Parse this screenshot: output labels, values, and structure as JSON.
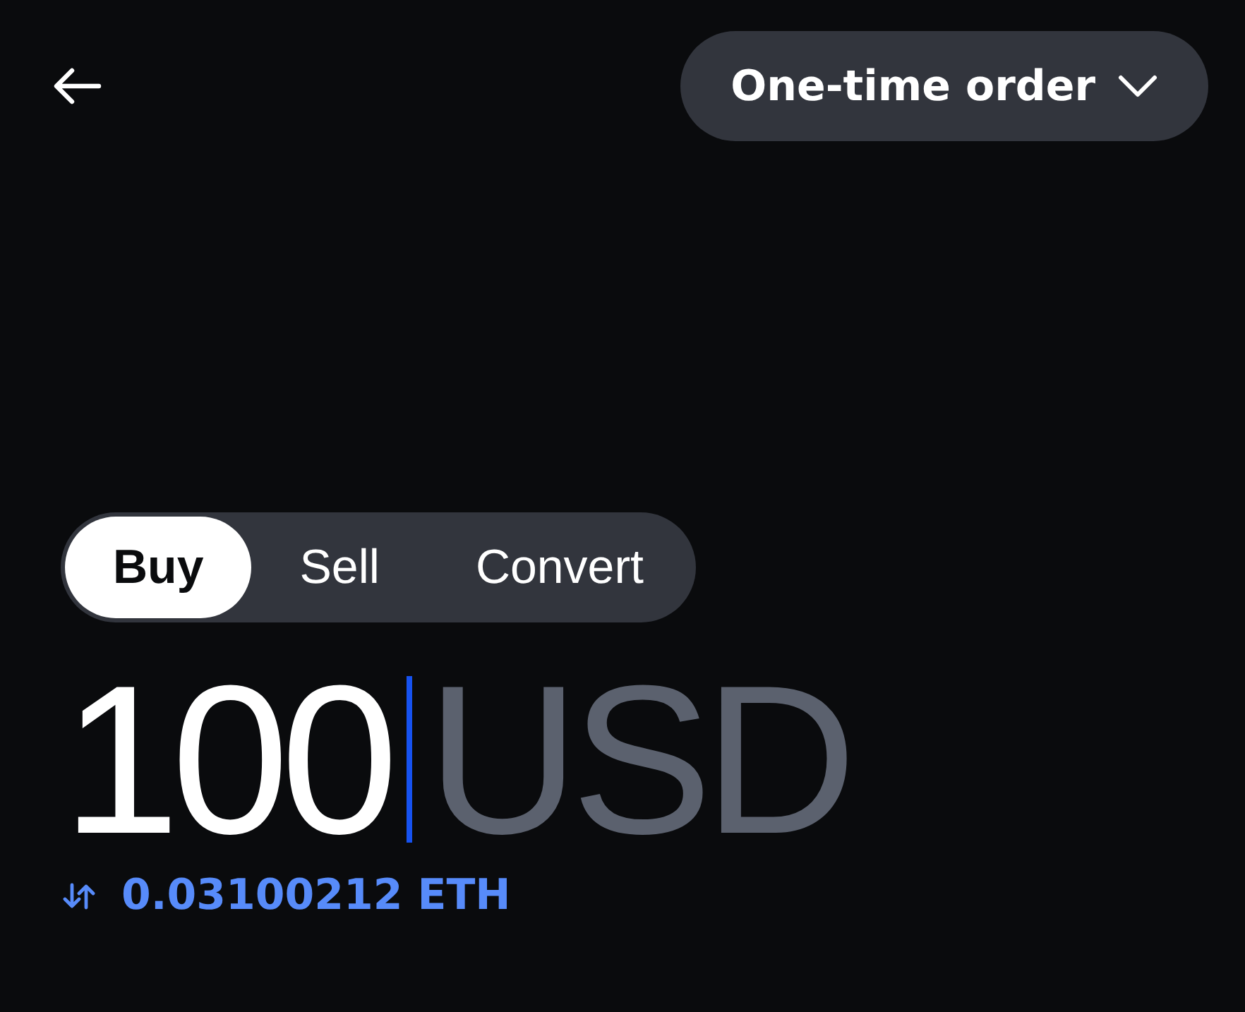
{
  "header": {
    "order_type": "One-time order"
  },
  "tabs": [
    {
      "label": "Buy",
      "selected": true
    },
    {
      "label": "Sell",
      "selected": false
    },
    {
      "label": "Convert",
      "selected": false
    }
  ],
  "amount": {
    "value": "100",
    "currency": "USD"
  },
  "conversion": {
    "text": "0.03100212 ETH"
  }
}
